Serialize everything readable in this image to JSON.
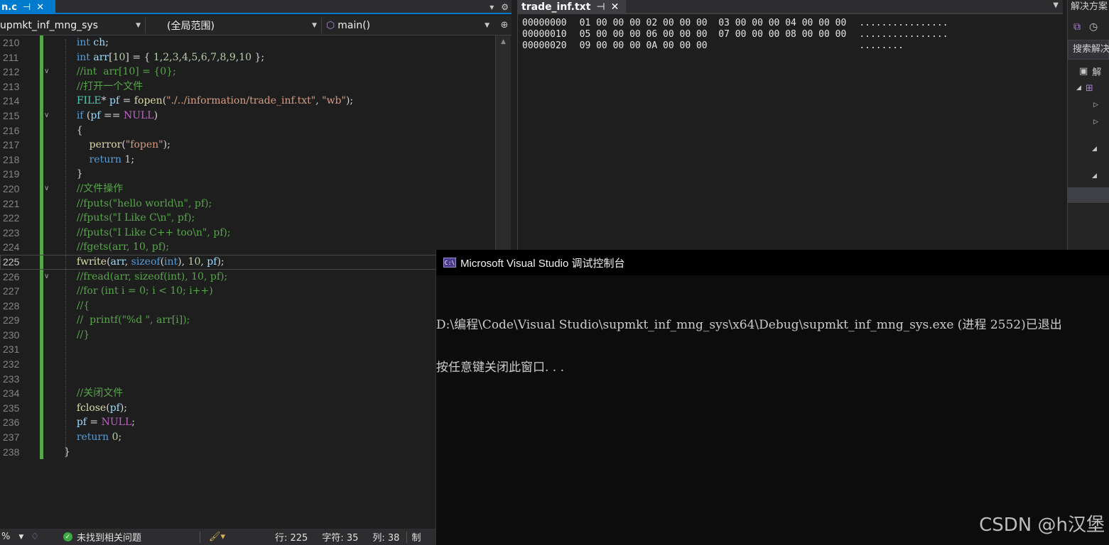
{
  "editor": {
    "tab": {
      "label": "n.c",
      "pin": "⊣",
      "close": "✕"
    },
    "tabbar_icons": {
      "dropdown": "▾",
      "settings": "⚙"
    },
    "nav": {
      "project": "upmkt_inf_mng_sys",
      "scope": "(全局范围)",
      "member": "main()"
    },
    "split_icon": "⊕",
    "lines": [
      {
        "n": "210",
        "fold": "",
        "html": "    <span class=\"kw\">int</span> <span class=\"var\">ch</span>;"
      },
      {
        "n": "211",
        "fold": "",
        "html": "    <span class=\"kw\">int</span> <span class=\"var\">arr</span>[<span class=\"num\">10</span>] = { <span class=\"num\">1</span>,<span class=\"num\">2</span>,<span class=\"num\">3</span>,<span class=\"num\">4</span>,<span class=\"num\">5</span>,<span class=\"num\">6</span>,<span class=\"num\">7</span>,<span class=\"num\">8</span>,<span class=\"num\">9</span>,<span class=\"num\">10</span> };"
      },
      {
        "n": "212",
        "fold": "∨",
        "html": "    <span class=\"cm\">//int  arr[10] = {0};</span>"
      },
      {
        "n": "213",
        "fold": "",
        "html": "    <span class=\"cm\">//打开一个文件</span>"
      },
      {
        "n": "214",
        "fold": "",
        "html": "    <span class=\"ty\">FILE</span>* <span class=\"var\">pf</span> = <span class=\"fn\">fopen</span>(<span class=\"str\">\"./../information/trade_inf.txt\"</span>, <span class=\"str\">\"wb\"</span>);"
      },
      {
        "n": "215",
        "fold": "∨",
        "html": "    <span class=\"kw\">if</span> (<span class=\"var\">pf</span> == <span class=\"mac\">NULL</span>)"
      },
      {
        "n": "216",
        "fold": "",
        "html": "    {"
      },
      {
        "n": "217",
        "fold": "",
        "html": "        <span class=\"fn\">perror</span>(<span class=\"str\">\"fopen\"</span>);"
      },
      {
        "n": "218",
        "fold": "",
        "html": "        <span class=\"kw\">return</span> <span class=\"num\">1</span>;"
      },
      {
        "n": "219",
        "fold": "",
        "html": "    }"
      },
      {
        "n": "220",
        "fold": "∨",
        "html": "    <span class=\"cm\">//文件操作</span>"
      },
      {
        "n": "221",
        "fold": "",
        "html": "    <span class=\"cm\">//fputs(\"hello world\\n\", pf);</span>"
      },
      {
        "n": "222",
        "fold": "",
        "html": "    <span class=\"cm\">//fputs(\"I Like C\\n\", pf);</span>"
      },
      {
        "n": "223",
        "fold": "",
        "html": "    <span class=\"cm\">//fputs(\"I Like C++ too\\n\", pf);</span>"
      },
      {
        "n": "224",
        "fold": "",
        "html": "    <span class=\"cm\">//fgets(arr, 10, pf);</span>"
      },
      {
        "n": "225",
        "fold": "",
        "current": true,
        "html": "    <span class=\"fn\">fwrite</span>(<span class=\"var\">arr</span>, <span class=\"kw\">sizeof</span>(<span class=\"kw\">int</span>), <span class=\"num\">10</span>, <span class=\"var\">pf</span>);"
      },
      {
        "n": "226",
        "fold": "∨",
        "html": "    <span class=\"cm\">//fread(arr, sizeof(int), 10, pf);</span>"
      },
      {
        "n": "227",
        "fold": "",
        "html": "    <span class=\"cm\">//for (int i = 0; i &lt; 10; i++)</span>"
      },
      {
        "n": "228",
        "fold": "",
        "html": "    <span class=\"cm\">//{</span>"
      },
      {
        "n": "229",
        "fold": "",
        "html": "    <span class=\"cm\">//  printf(\"%d \", arr[i]);</span>"
      },
      {
        "n": "230",
        "fold": "",
        "html": "    <span class=\"cm\">//}</span>"
      },
      {
        "n": "231",
        "fold": "",
        "html": ""
      },
      {
        "n": "232",
        "fold": "",
        "html": ""
      },
      {
        "n": "233",
        "fold": "",
        "html": ""
      },
      {
        "n": "234",
        "fold": "",
        "html": "    <span class=\"cm\">//关闭文件</span>"
      },
      {
        "n": "235",
        "fold": "",
        "html": "    <span class=\"fn\">fclose</span>(<span class=\"var\">pf</span>);"
      },
      {
        "n": "236",
        "fold": "",
        "html": "    <span class=\"var\">pf</span> = <span class=\"mac\">NULL</span>;"
      },
      {
        "n": "237",
        "fold": "",
        "html": "    <span class=\"kw\">return</span> <span class=\"num\">0</span>;"
      },
      {
        "n": "238",
        "fold": "",
        "html": "}"
      }
    ]
  },
  "status": {
    "zoom": "%",
    "issues": "未找到相关问题",
    "line": "行: 225",
    "char": "字符: 35",
    "col": "列: 38",
    "trailing": "制"
  },
  "hex": {
    "tab": {
      "label": "trade_inf.txt",
      "pin": "⊣",
      "close": "✕"
    },
    "rows": [
      {
        "addr": "00000000",
        "bytes": "01 00 00 00 02 00 00 00  03 00 00 00 04 00 00 00",
        "ascii": "................"
      },
      {
        "addr": "00000010",
        "bytes": "05 00 00 00 06 00 00 00  07 00 00 00 08 00 00 00",
        "ascii": "................"
      },
      {
        "addr": "00000020",
        "bytes": "09 00 00 00 0A 00 00 00                         ",
        "ascii": "........"
      }
    ]
  },
  "solution": {
    "title": "解决方案",
    "search": "搜索解决",
    "item": "解"
  },
  "console": {
    "icon": "C:\\",
    "title": "Microsoft Visual Studio 调试控制台",
    "line1": "D:\\编程\\Code\\Visual Studio\\supmkt_inf_mng_sys\\x64\\Debug\\supmkt_inf_mng_sys.exe (进程 2552)已退出",
    "line2": "按任意键关闭此窗口. . ."
  },
  "watermark": "CSDN @h汉堡"
}
